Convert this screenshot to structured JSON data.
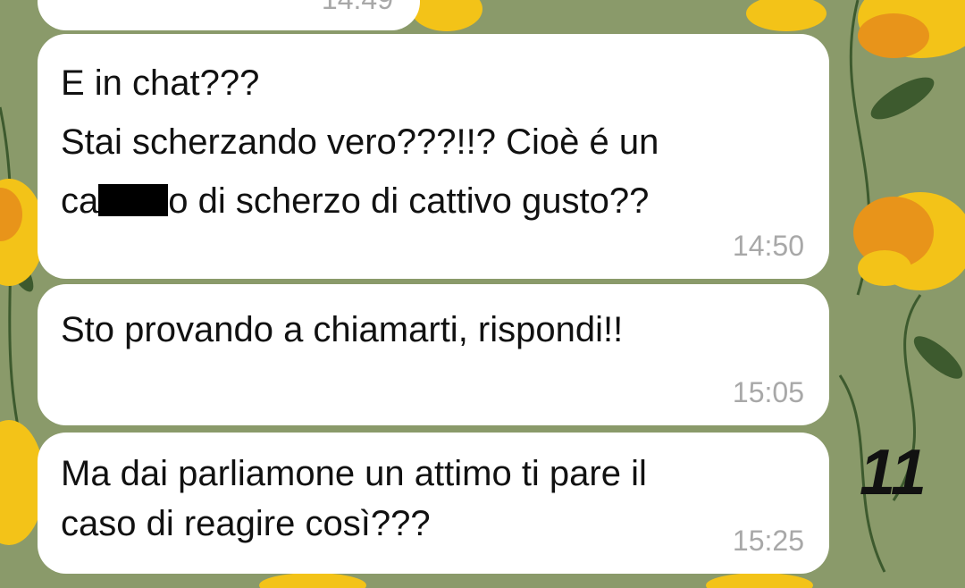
{
  "colors": {
    "wallpaper": "#8a9a6a",
    "flower_yellow": "#f3c318",
    "flower_orange": "#e8941a",
    "leaf": "#3d5a2e",
    "bubble": "#ffffff",
    "timestamp": "#a8a8a8"
  },
  "messages": [
    {
      "text": "",
      "time": "14:49"
    },
    {
      "line1": "E in chat???",
      "line2": "Stai scherzando vero???!!? Cioè é un",
      "line3_pre": "ca",
      "line3_post": "o di scherzo di cattivo gusto??",
      "time": "14:50",
      "redacted": true
    },
    {
      "text": "Sto provando a chiamarti, rispondi!!",
      "time": "15:05"
    },
    {
      "text": "Ma dai parliamone un attimo ti pare il\ncaso di reagire così???",
      "time": "15:25"
    }
  ],
  "annotation": {
    "label": "11"
  }
}
